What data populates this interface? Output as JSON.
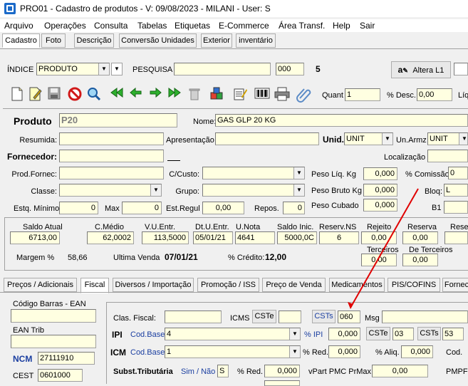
{
  "window": {
    "title": "PRO01 - Cadastro de produtos - V: 09/08/2023 - MILANI - User: S"
  },
  "menu": [
    "Arquivo",
    "Operações",
    "Consulta",
    "Tabelas",
    "Etiquetas",
    "E-Commerce",
    "Área Transf.",
    "Help",
    "Sair"
  ],
  "top_tabs": [
    "Cadastro",
    "Foto",
    "Descrição",
    "Conversão Unidades",
    "Exterior",
    "inventário"
  ],
  "search": {
    "indice_label": "ÍNDICE",
    "indice_value": "PRODUTO",
    "pesquisa_label": "PESQUISA",
    "pesquisa_value": "",
    "code_value": "000",
    "count": "5",
    "altera_label": "Altera L1"
  },
  "toolbar": {
    "quant_label": "Quant",
    "quant_value": "1",
    "desc_label": "% Desc.",
    "desc_value": "0,00",
    "liq_label": "Líq"
  },
  "produto": {
    "produto_label": "Produto",
    "code": "P20",
    "nome_label": "Nome:",
    "nome_value": "GAS GLP 20 KG",
    "resumida_label": "Resumida:",
    "apresentacao_label": "Apresentação",
    "unid_label": "Unid.",
    "unid_value": "UNIT",
    "unarmz_label": "Un.Armz",
    "unarmz_value": "UNIT",
    "fornecedor_label": "Fornecedor:",
    "localizacao_label": "Localização",
    "prodfornec_label": "Prod.Fornec:",
    "ccusto_label": "C/Custo:",
    "peso_liq_label": "Peso Líq. Kg",
    "peso_liq_value": "0,000",
    "comissao_label": "% Comissão",
    "comissao_value": "0",
    "classe_label": "Classe:",
    "grupo_label": "Grupo:",
    "peso_bruto_label": "Peso Bruto Kg",
    "peso_bruto_value": "0,000",
    "bloq_label": "Bloq:",
    "bloq_value": "L",
    "estq_min_label": "Estq. Mínimo",
    "estq_min_value": "0",
    "max_label": "Max",
    "max_value": "0",
    "est_regul_label": "Est.Regul",
    "est_regul_value": "0,00",
    "repos_label": "Repos.",
    "repos_value": "0",
    "peso_cubado_label": "Peso Cubado",
    "peso_cubado_value": "0,000",
    "b1_label": "B1"
  },
  "estoque": {
    "headers": [
      "Saldo Atual",
      "C.Médio",
      "V.U.Entr.",
      "Dt.U.Entr.",
      "U.Nota",
      "Saldo Inic.",
      "Reserv.NS",
      "Rejeito",
      "Reserva",
      "Rese"
    ],
    "values": [
      "6713,00",
      "62,0002",
      "113,5000",
      "05/01/21",
      "4641",
      "5000,0C",
      "6",
      "0,00",
      "0,00",
      ""
    ],
    "terceiros_label": "Terceiros",
    "terceiros_value": "0,00",
    "de_terceiros_label": "De Terceiros",
    "de_terceiros_value": "0,00",
    "margem_label": "Margem  %",
    "margem_value": "58,66",
    "ultima_venda_label": "Ultima Venda",
    "ultima_venda_value": "07/01/21",
    "credito_label": "% Crédito:",
    "credito_value": "12,00"
  },
  "bottom_tabs": [
    "Preços / Adicionais",
    "Fiscal",
    "Diversos / Importação",
    "Promoção / ISS",
    "Preço de Venda",
    "Medicamentos",
    "PIS/COFINS",
    "Fornec"
  ],
  "fiscal": {
    "ean_label": "Código Barras - EAN",
    "ean_trib_label": "EAN Trib",
    "ncm_label": "NCM",
    "ncm_value": "27111910",
    "cest_label": "CEST",
    "cest_value": "0601000",
    "clas_fiscal_label": "Clas. Fiscal:",
    "icms_label": "ICMS",
    "cste_label": "CSTe",
    "csts_label": "CSTs",
    "csts_value": "060",
    "msg_label": "Msg",
    "ipi_label": "IPI",
    "cod_base_label": "Cod.Base",
    "ipi_base_value": "4",
    "pct_ipi_label": "% IPI",
    "pct_ipi_value": "0,000",
    "ipi_cste_value": "03",
    "ipi_csts_value": "53",
    "icm_label": "ICM",
    "icm_base_value": "1",
    "red_label": "% Red.",
    "red_value": "0,000",
    "aliq_label": "% Aliq.",
    "aliq_value": "0,000",
    "cod_label": "Cod.",
    "subst_label": "Subst.Tributária",
    "simnao_label": "Sim / Não",
    "simnao_value": "S",
    "subst_red_label": "% Red.",
    "subst_red_value": "0,000",
    "vpart_label": "vPart PMC PrMax",
    "vpart_value": "0,00",
    "pmpf_label": "PMPF"
  }
}
